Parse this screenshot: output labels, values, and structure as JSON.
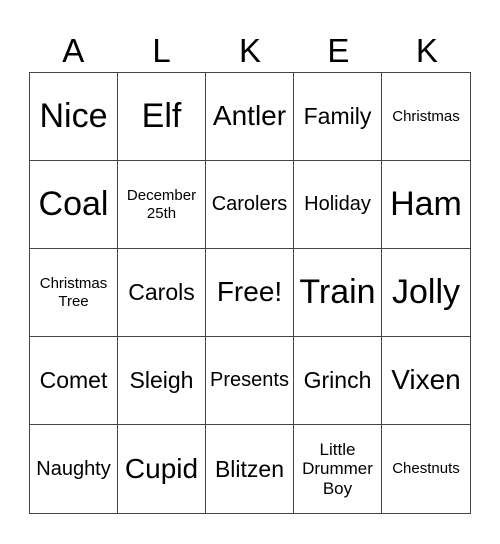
{
  "header": [
    "A",
    "L",
    "K",
    "E",
    "K"
  ],
  "cells": [
    {
      "text": "Nice",
      "size": "xl"
    },
    {
      "text": "Elf",
      "size": "xl"
    },
    {
      "text": "Antler",
      "size": "l"
    },
    {
      "text": "Family",
      "size": "m"
    },
    {
      "text": "Christmas",
      "size": "xxs"
    },
    {
      "text": "Coal",
      "size": "xl"
    },
    {
      "text": "December 25th",
      "size": "xxs"
    },
    {
      "text": "Carolers",
      "size": "s"
    },
    {
      "text": "Holiday",
      "size": "s"
    },
    {
      "text": "Ham",
      "size": "xl"
    },
    {
      "text": "Christmas Tree",
      "size": "xxs"
    },
    {
      "text": "Carols",
      "size": "m"
    },
    {
      "text": "Free!",
      "size": "l"
    },
    {
      "text": "Train",
      "size": "xl"
    },
    {
      "text": "Jolly",
      "size": "xl"
    },
    {
      "text": "Comet",
      "size": "m"
    },
    {
      "text": "Sleigh",
      "size": "m"
    },
    {
      "text": "Presents",
      "size": "s"
    },
    {
      "text": "Grinch",
      "size": "m"
    },
    {
      "text": "Vixen",
      "size": "l"
    },
    {
      "text": "Naughty",
      "size": "s"
    },
    {
      "text": "Cupid",
      "size": "l"
    },
    {
      "text": "Blitzen",
      "size": "m"
    },
    {
      "text": "Little Drummer Boy",
      "size": "xs"
    },
    {
      "text": "Chestnuts",
      "size": "xxs"
    }
  ]
}
